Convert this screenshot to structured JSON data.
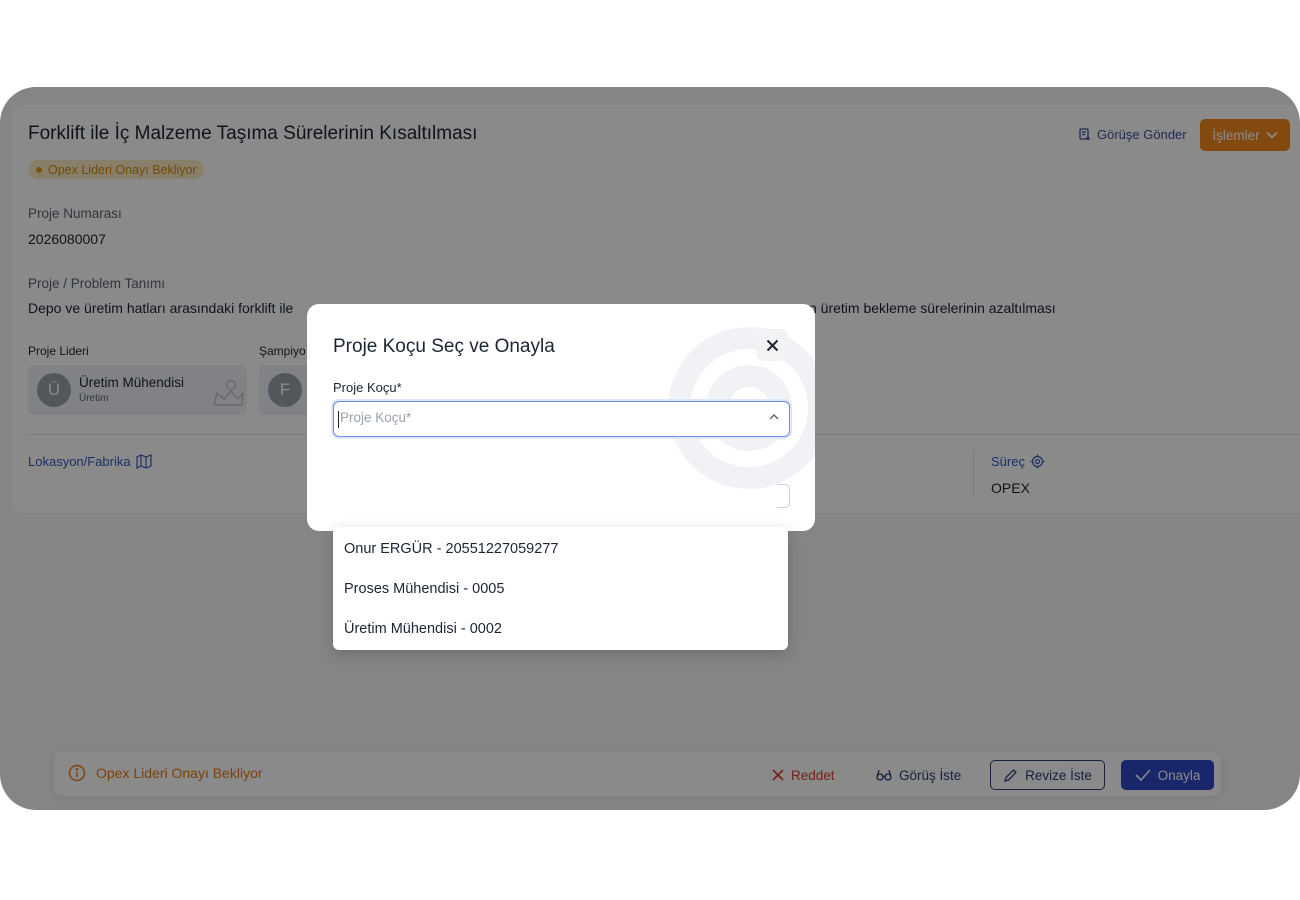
{
  "project": {
    "title": "Forklift ile İç Malzeme Taşıma Sürelerinin Kısaltılması",
    "status_badge": "Opex Lideri Onayı Bekliyor",
    "number_label": "Proje Numarası",
    "number_value": "2026080007",
    "problem_label": "Proje / Problem Tanımı",
    "problem_text_left": "Depo ve üretim hatları arasındaki forklift ile",
    "problem_text_right": "n üretim bekleme sürelerinin azaltılması",
    "leader_label": "Proje Lideri",
    "champion_label": "Şampiyo",
    "leader_initial": "Ü",
    "leader_name": "Üretim Mühendisi",
    "leader_dept": "Üretim",
    "champion_initial": "F",
    "location_label": "Lokasyon/Fabrika",
    "process_label": "Süreç",
    "process_value": "OPEX"
  },
  "header": {
    "send_review_label": "Görüşe Gönder",
    "actions_label": "İşlemler"
  },
  "action_bar": {
    "status_text": "Opex Lideri Onayı Bekliyor",
    "reject_label": "Reddet",
    "request_review_label": "Görüş İste",
    "request_revision_label": "Revize İste",
    "approve_label": "Onayla"
  },
  "modal": {
    "title": "Proje Koçu Seç ve Onayla",
    "field_label": "Proje Koçu*",
    "select_placeholder": "Proje Koçu*",
    "options": [
      "Onur ERGÜR - 20551227059277",
      "Proses Mühendisi - 0005",
      "Üretim Mühendisi - 0002"
    ]
  },
  "colors": {
    "accent_orange": "#f08a1c",
    "primary_blue": "#2f48c4",
    "danger_red": "#e23a2e"
  }
}
